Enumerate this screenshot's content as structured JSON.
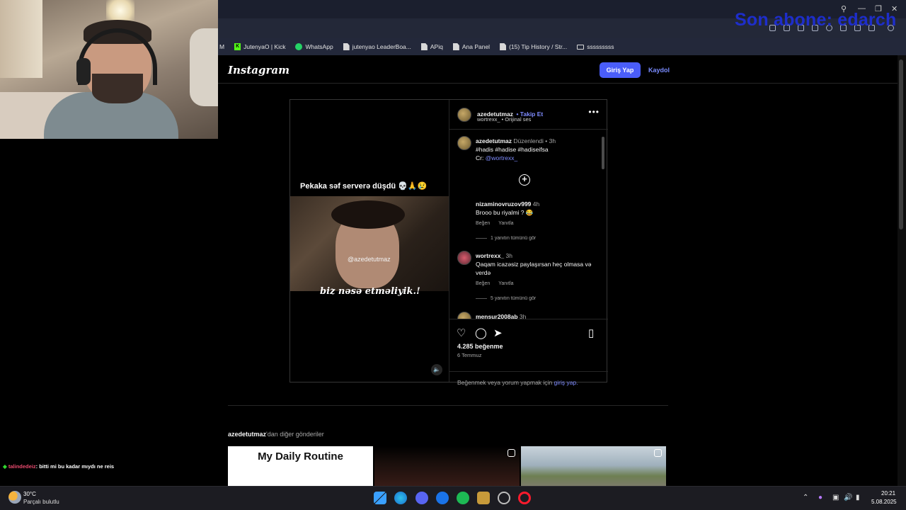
{
  "overlay": {
    "stream_text": "Son abone: edarch"
  },
  "browser": {
    "bookmarks": [
      {
        "label": "M",
        "icon": "kick-icon"
      },
      {
        "label": "JutenyaO | Kick",
        "icon": "kick-icon"
      },
      {
        "label": "WhatsApp",
        "icon": "whatsapp-icon"
      },
      {
        "label": "jutenyao LeaderBoa...",
        "icon": "document-icon"
      },
      {
        "label": "APiq",
        "icon": "document-icon"
      },
      {
        "label": "Ana Panel",
        "icon": "document-icon"
      },
      {
        "label": "(15) Tip History / Str...",
        "icon": "document-icon"
      },
      {
        "label": "sssssssss",
        "icon": "folder-icon"
      }
    ]
  },
  "instagram": {
    "logo": "Instagram",
    "login_button": "Giriş Yap",
    "signup_link": "Kaydol",
    "post": {
      "video_caption": "Pekaka səf serverə düşdü 💀🙏😢",
      "video_watermark": "@azedetutmaz",
      "video_subtitle": "biz nəsə etməliyik.!",
      "author": "azedetutmaz",
      "follow": "• Takip Et",
      "audio": "wortrexx_ • Orijinal ses",
      "caption": {
        "user": "azedetutmaz",
        "edited": "Düzenlendi",
        "time": "• 3h",
        "hashtags": "#hadis #hadise #hadiseifsa",
        "credit_prefix": "Cr:",
        "credit_handle": "@wortrexx_"
      },
      "comments": [
        {
          "user": "nizaminovruzov999",
          "time": "4h",
          "text": "Brooo bu riyalmi ? 😂",
          "like": "Beğen",
          "reply": "Yanıtla",
          "replies": "1 yanıtın tümünü gör"
        },
        {
          "user": "wortrexx_",
          "time": "3h",
          "text": "Qaqam icazəsiz paylaşırsan heç olmasa və verdə",
          "like": "Beğen",
          "reply": "Yanıtla",
          "replies": "5 yanıtın tümünü gör"
        },
        {
          "user": "mensur2008ab",
          "time": "3h",
          "text": "",
          "like": "",
          "reply": "",
          "replies": ""
        }
      ],
      "likes": "4.285 beğenme",
      "date": "6 Temmuz",
      "login_prompt_prefix": "Beğenmek veya yorum yapmak için",
      "login_prompt_link": "giriş yap."
    },
    "more_posts": {
      "author": "azedetutmaz",
      "suffix": "'dan diğer gönderiler",
      "first_title": "My Daily Routine"
    }
  },
  "chat": {
    "user": "talindedeiz",
    "message": ": bitti mi bu kadar mıydı ne reis"
  },
  "taskbar": {
    "temperature": "30°C",
    "weather": "Parçalı bulutlu",
    "time": "20:21",
    "date": "5.08.2025"
  },
  "colors": {
    "accent": "#4a5df9",
    "link": "#7f8cff",
    "background": "#000000",
    "overlay": "#1e2fd8"
  }
}
